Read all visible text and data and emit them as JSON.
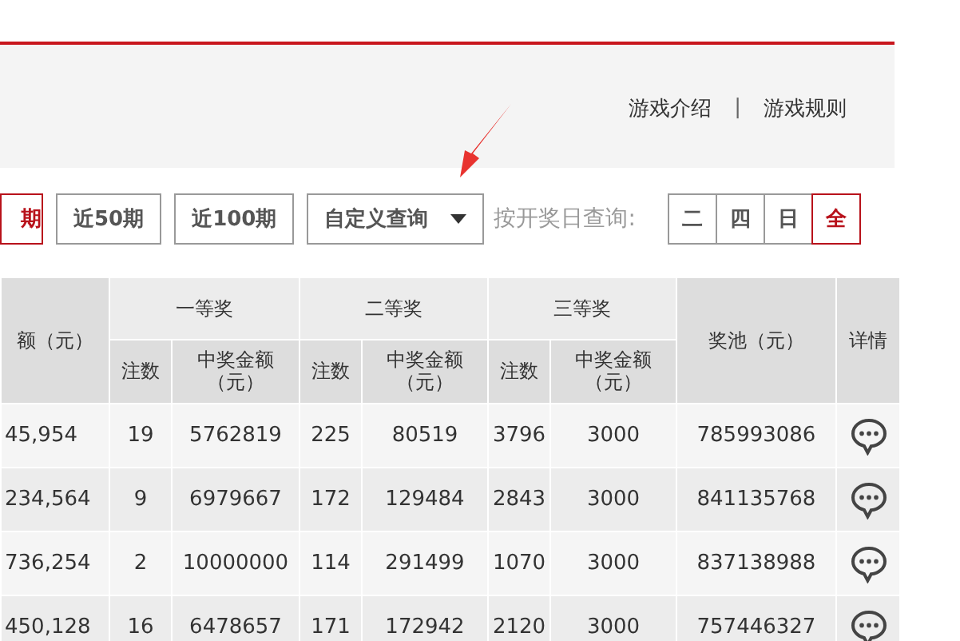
{
  "header_links": [
    {
      "label": "游戏介绍"
    },
    {
      "label": "游戏规则"
    }
  ],
  "link_separator": "|",
  "period_buttons": [
    {
      "label": "期",
      "selected": true
    },
    {
      "label": "近50期",
      "selected": false
    },
    {
      "label": "近100期",
      "selected": false
    }
  ],
  "custom_query": {
    "label": "自定义查询"
  },
  "day_filter": {
    "label": "按开奖日查询:",
    "options": [
      {
        "label": "二",
        "selected": false
      },
      {
        "label": "四",
        "selected": false
      },
      {
        "label": "日",
        "selected": false
      },
      {
        "label": "全",
        "selected": true
      }
    ]
  },
  "table": {
    "first_column": "额（元）",
    "groups": [
      {
        "label": "一等奖",
        "count": "注数",
        "amount": "中奖金额（元）"
      },
      {
        "label": "二等奖",
        "count": "注数",
        "amount": "中奖金额（元）"
      },
      {
        "label": "三等奖",
        "count": "注数",
        "amount": "中奖金额（元）"
      }
    ],
    "pool_column": "奖池（元）",
    "detail_column": "详情",
    "rows": [
      [
        "45,954",
        "19",
        "5762819",
        "225",
        "80519",
        "3796",
        "3000",
        "785993086"
      ],
      [
        "234,564",
        "9",
        "6979667",
        "172",
        "129484",
        "2843",
        "3000",
        "841135768"
      ],
      [
        "736,254",
        "2",
        "10000000",
        "114",
        "291499",
        "1070",
        "3000",
        "837138988"
      ],
      [
        "450,128",
        "16",
        "6478657",
        "171",
        "172942",
        "2120",
        "3000",
        "757446327"
      ]
    ]
  }
}
